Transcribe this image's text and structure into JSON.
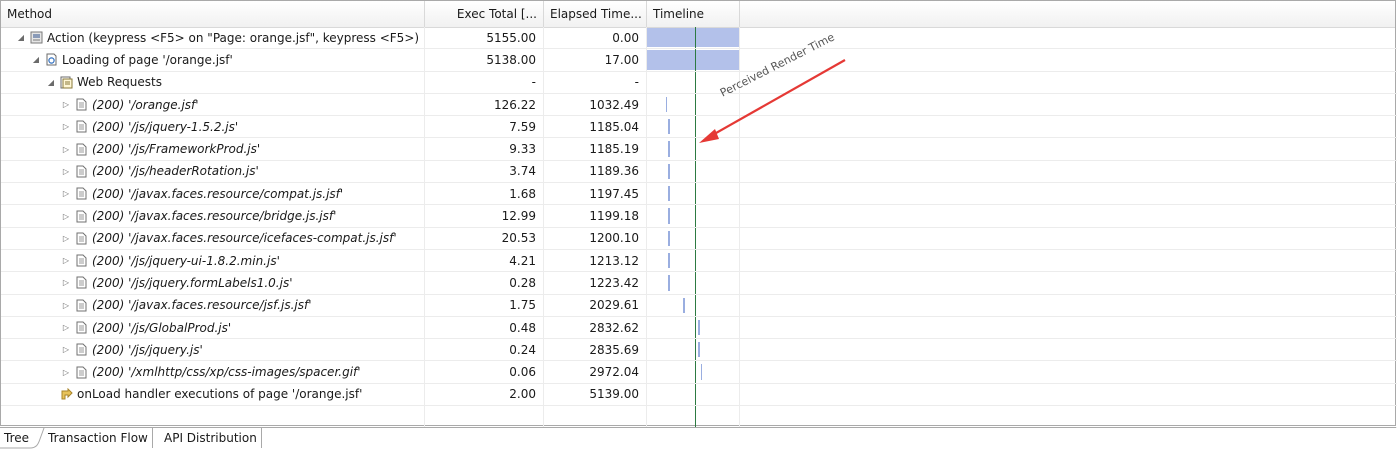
{
  "columns": {
    "method": "Method",
    "exec_total": "Exec Total [...",
    "elapsed_time": "Elapsed Time...",
    "timeline": "Timeline"
  },
  "rows": [
    {
      "label": "Action (keypress <F5> on \"Page: orange.jsf\", keypress <F5>)",
      "exec": "5155.00",
      "elapsed": "0.00",
      "indent": 0,
      "expander": "expanded",
      "icon": "action-icon",
      "italic": false,
      "bar": {
        "start": 0.0,
        "end": 1.0,
        "kind": "full"
      }
    },
    {
      "label": "Loading of page '/orange.jsf'",
      "exec": "5138.00",
      "elapsed": "17.00",
      "indent": 1,
      "expander": "expanded",
      "icon": "page-load-icon",
      "italic": false,
      "bar": {
        "start": 0.0,
        "end": 0.99,
        "kind": "full"
      }
    },
    {
      "label": "Web Requests",
      "exec": "-",
      "elapsed": "-",
      "indent": 2,
      "expander": "expanded",
      "icon": "web-requests-icon",
      "italic": false,
      "bar": null
    },
    {
      "label": "(200) '/orange.jsf'",
      "exec": "126.22",
      "elapsed": "1032.49",
      "indent": 3,
      "expander": "collapsed",
      "icon": "document-icon",
      "italic": true,
      "bar": {
        "start": 0.2,
        "end": 0.22,
        "kind": "thin"
      }
    },
    {
      "label": "(200) '/js/jquery-1.5.2.js'",
      "exec": "7.59",
      "elapsed": "1185.04",
      "indent": 3,
      "expander": "collapsed",
      "icon": "document-icon",
      "italic": true,
      "bar": {
        "start": 0.23,
        "end": 0.24,
        "kind": "thin"
      }
    },
    {
      "label": "(200) '/js/FrameworkProd.js'",
      "exec": "9.33",
      "elapsed": "1185.19",
      "indent": 3,
      "expander": "collapsed",
      "icon": "document-icon",
      "italic": true,
      "bar": {
        "start": 0.23,
        "end": 0.24,
        "kind": "thin"
      }
    },
    {
      "label": "(200) '/js/headerRotation.js'",
      "exec": "3.74",
      "elapsed": "1189.36",
      "indent": 3,
      "expander": "collapsed",
      "icon": "document-icon",
      "italic": true,
      "bar": {
        "start": 0.23,
        "end": 0.24,
        "kind": "thin"
      }
    },
    {
      "label": "(200) '/javax.faces.resource/compat.js.jsf'",
      "exec": "1.68",
      "elapsed": "1197.45",
      "indent": 3,
      "expander": "collapsed",
      "icon": "document-icon",
      "italic": true,
      "bar": {
        "start": 0.23,
        "end": 0.24,
        "kind": "thin"
      }
    },
    {
      "label": "(200) '/javax.faces.resource/bridge.js.jsf'",
      "exec": "12.99",
      "elapsed": "1199.18",
      "indent": 3,
      "expander": "collapsed",
      "icon": "document-icon",
      "italic": true,
      "bar": {
        "start": 0.23,
        "end": 0.24,
        "kind": "thin"
      }
    },
    {
      "label": "(200) '/javax.faces.resource/icefaces-compat.js.jsf'",
      "exec": "20.53",
      "elapsed": "1200.10",
      "indent": 3,
      "expander": "collapsed",
      "icon": "document-icon",
      "italic": true,
      "bar": {
        "start": 0.23,
        "end": 0.24,
        "kind": "thin"
      }
    },
    {
      "label": "(200) '/js/jquery-ui-1.8.2.min.js'",
      "exec": "4.21",
      "elapsed": "1213.12",
      "indent": 3,
      "expander": "collapsed",
      "icon": "document-icon",
      "italic": true,
      "bar": {
        "start": 0.23,
        "end": 0.24,
        "kind": "thin"
      }
    },
    {
      "label": "(200) '/js/jquery.formLabels1.0.js'",
      "exec": "0.28",
      "elapsed": "1223.42",
      "indent": 3,
      "expander": "collapsed",
      "icon": "document-icon",
      "italic": true,
      "bar": {
        "start": 0.23,
        "end": 0.24,
        "kind": "thin"
      }
    },
    {
      "label": "(200) '/javax.faces.resource/jsf.js.jsf'",
      "exec": "1.75",
      "elapsed": "2029.61",
      "indent": 3,
      "expander": "collapsed",
      "icon": "document-icon",
      "italic": true,
      "bar": {
        "start": 0.39,
        "end": 0.4,
        "kind": "thin"
      }
    },
    {
      "label": "(200) '/js/GlobalProd.js'",
      "exec": "0.48",
      "elapsed": "2832.62",
      "indent": 3,
      "expander": "collapsed",
      "icon": "document-icon",
      "italic": true,
      "bar": {
        "start": 0.55,
        "end": 0.56,
        "kind": "thin"
      }
    },
    {
      "label": "(200) '/js/jquery.js'",
      "exec": "0.24",
      "elapsed": "2835.69",
      "indent": 3,
      "expander": "collapsed",
      "icon": "document-icon",
      "italic": true,
      "bar": {
        "start": 0.55,
        "end": 0.56,
        "kind": "thin"
      }
    },
    {
      "label": "(200) '/xmlhttp/css/xp/css-images/spacer.gif'",
      "exec": "0.06",
      "elapsed": "2972.04",
      "indent": 3,
      "expander": "collapsed",
      "icon": "document-icon",
      "italic": true,
      "bar": {
        "start": 0.58,
        "end": 0.59,
        "kind": "thin"
      }
    },
    {
      "label": "onLoad handler executions of page '/orange.jsf'",
      "exec": "2.00",
      "elapsed": "5139.00",
      "indent": 2,
      "expander": "none",
      "icon": "onload-handler-icon",
      "italic": false,
      "bar": {
        "start": 0.99,
        "end": 1.0,
        "kind": "thin"
      }
    },
    {
      "label": "",
      "exec": "",
      "elapsed": "",
      "indent": 0,
      "expander": "none",
      "icon": "",
      "italic": false,
      "bar": null
    }
  ],
  "perceived_render_marker": {
    "fraction": 0.52,
    "color": "#2d7a42"
  },
  "annotation": {
    "text": "Perceived Render Time",
    "arrow_color": "#e53935"
  },
  "tabs": [
    {
      "label": "Tree",
      "active": true
    },
    {
      "label": "Transaction Flow",
      "active": false
    },
    {
      "label": "API Distribution",
      "active": false
    }
  ],
  "colors": {
    "timeline_bar": "#b3c1ea",
    "thin_bar": "#9aaee0"
  }
}
